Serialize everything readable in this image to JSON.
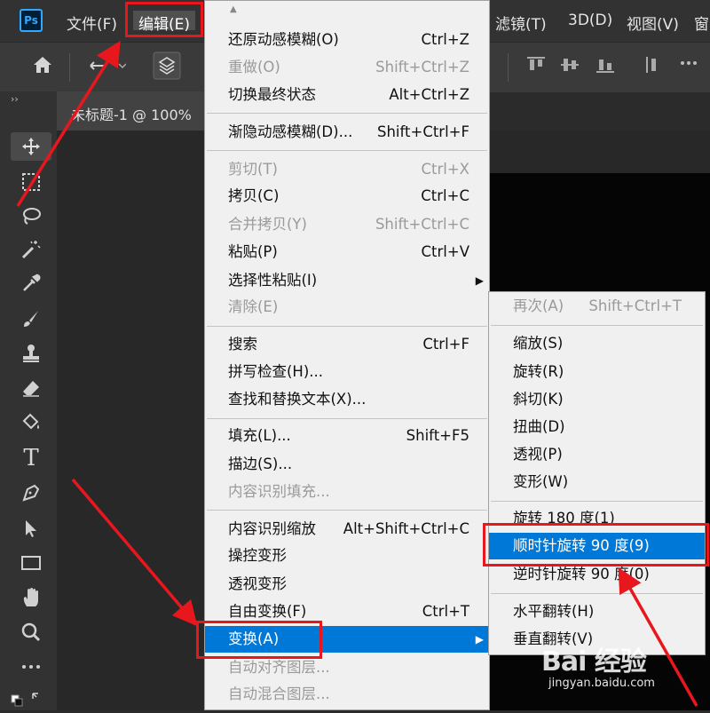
{
  "app": {
    "logo_text": "Ps",
    "menus": [
      {
        "label": "文件(F)"
      },
      {
        "label": "编辑(E)"
      },
      {
        "label": "滤镜(T)"
      },
      {
        "label": "3D(D)"
      },
      {
        "label": "视图(V)"
      },
      {
        "label": "窗"
      }
    ],
    "collapse": "››"
  },
  "document": {
    "tab_label": "未标题-1 @ 100%"
  },
  "edit_menu": {
    "items": [
      {
        "label": "还原动感模糊(O)",
        "shortcut": "Ctrl+Z",
        "disabled": false
      },
      {
        "label": "重做(O)",
        "shortcut": "Shift+Ctrl+Z",
        "disabled": true
      },
      {
        "label": "切换最终状态",
        "shortcut": "Alt+Ctrl+Z",
        "disabled": false
      },
      {
        "label": "渐隐动感模糊(D)...",
        "shortcut": "Shift+Ctrl+F",
        "disabled": false
      },
      {
        "label": "剪切(T)",
        "shortcut": "Ctrl+X",
        "disabled": true
      },
      {
        "label": "拷贝(C)",
        "shortcut": "Ctrl+C",
        "disabled": false
      },
      {
        "label": "合并拷贝(Y)",
        "shortcut": "Shift+Ctrl+C",
        "disabled": true
      },
      {
        "label": "粘贴(P)",
        "shortcut": "Ctrl+V",
        "disabled": false
      },
      {
        "label": "选择性粘贴(I)",
        "shortcut": "",
        "disabled": false
      },
      {
        "label": "清除(E)",
        "shortcut": "",
        "disabled": true
      },
      {
        "label": "搜索",
        "shortcut": "Ctrl+F",
        "disabled": false
      },
      {
        "label": "拼写检查(H)...",
        "shortcut": "",
        "disabled": false
      },
      {
        "label": "查找和替换文本(X)...",
        "shortcut": "",
        "disabled": false
      },
      {
        "label": "填充(L)...",
        "shortcut": "Shift+F5",
        "disabled": false
      },
      {
        "label": "描边(S)...",
        "shortcut": "",
        "disabled": false
      },
      {
        "label": "内容识别填充...",
        "shortcut": "",
        "disabled": true
      },
      {
        "label": "内容识别缩放",
        "shortcut": "Alt+Shift+Ctrl+C",
        "disabled": false
      },
      {
        "label": "操控变形",
        "shortcut": "",
        "disabled": false
      },
      {
        "label": "透视变形",
        "shortcut": "",
        "disabled": false
      },
      {
        "label": "自由变换(F)",
        "shortcut": "Ctrl+T",
        "disabled": false
      },
      {
        "label": "变换(A)",
        "shortcut": "",
        "disabled": false
      },
      {
        "label": "自动对齐图层...",
        "shortcut": "",
        "disabled": true
      },
      {
        "label": "自动混合图层...",
        "shortcut": "",
        "disabled": true
      }
    ]
  },
  "transform_menu": {
    "items": [
      {
        "label": "再次(A)",
        "shortcut": "Shift+Ctrl+T",
        "disabled": true
      },
      {
        "label": "缩放(S)",
        "disabled": false
      },
      {
        "label": "旋转(R)",
        "disabled": false
      },
      {
        "label": "斜切(K)",
        "disabled": false
      },
      {
        "label": "扭曲(D)",
        "disabled": false
      },
      {
        "label": "透视(P)",
        "disabled": false
      },
      {
        "label": "变形(W)",
        "disabled": false
      },
      {
        "label": "旋转 180 度(1)",
        "disabled": false
      },
      {
        "label": "顺时针旋转 90 度(9)",
        "disabled": false
      },
      {
        "label": "逆时针旋转 90 度(0)",
        "disabled": false
      },
      {
        "label": "水平翻转(H)",
        "disabled": false
      },
      {
        "label": "垂直翻转(V)",
        "disabled": false
      }
    ]
  },
  "watermark": {
    "logo": "Bai 经验",
    "url": "jingyan.baidu.com"
  },
  "colors": {
    "highlight_red": "#e8171e",
    "selection_blue": "#0078d7"
  }
}
